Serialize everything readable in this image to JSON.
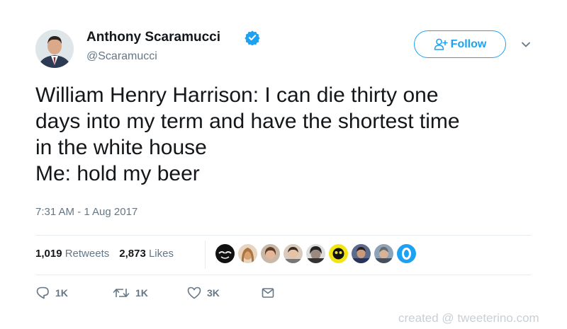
{
  "user": {
    "display_name": "Anthony Scaramucci",
    "handle": "@Scaramucci",
    "verified": true
  },
  "follow_button": {
    "label": "Follow"
  },
  "tweet": {
    "lines": [
      "William Henry Harrison: I can die thirty one",
      "days into my term and have the shortest time",
      "in the white house",
      "Me: hold my beer"
    ],
    "timestamp": "7:31 AM - 1 Aug 2017"
  },
  "stats": {
    "retweets_count": "1,019",
    "retweets_label": "Retweets",
    "likes_count": "2,873",
    "likes_label": "Likes"
  },
  "actions": {
    "reply_count": "1K",
    "retweet_count": "1K",
    "like_count": "3K"
  },
  "watermark": "created @ tweeterino.com",
  "colors": {
    "brand_blue": "#1da1f2",
    "text_primary": "#14171a",
    "text_secondary": "#657786",
    "divider": "#e6ecf0"
  },
  "icons": {
    "verified": "verified-badge-icon",
    "follow": "add-person-icon",
    "caret": "chevron-down-icon",
    "reply": "reply-icon",
    "retweet": "retweet-icon",
    "like": "heart-icon",
    "dm": "envelope-icon"
  }
}
